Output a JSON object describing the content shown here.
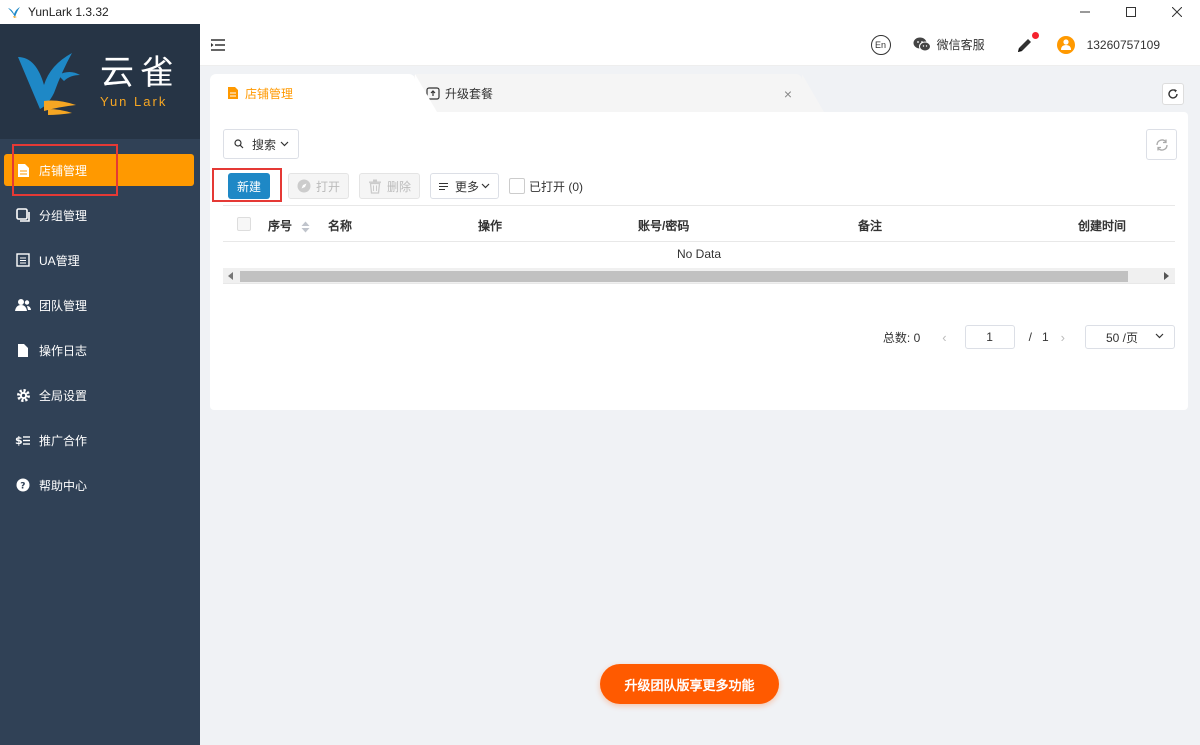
{
  "window": {
    "title": "YunLark 1.3.32"
  },
  "logo": {
    "cn": "云雀",
    "en": "Yun Lark"
  },
  "sidebar": {
    "items": [
      {
        "label": "店铺管理",
        "icon": "document-icon",
        "active": true
      },
      {
        "label": "分组管理",
        "icon": "copy-icon",
        "active": false
      },
      {
        "label": "UA管理",
        "icon": "list-icon",
        "active": false
      },
      {
        "label": "团队管理",
        "icon": "team-icon",
        "active": false
      },
      {
        "label": "操作日志",
        "icon": "file-icon",
        "active": false
      },
      {
        "label": "全局设置",
        "icon": "gear-icon",
        "active": false
      },
      {
        "label": "推广合作",
        "icon": "dollar-icon",
        "active": false
      },
      {
        "label": "帮助中心",
        "icon": "help-icon",
        "active": false
      }
    ]
  },
  "header": {
    "lang": "En",
    "wechat_label": "微信客服",
    "user_phone": "13260757109"
  },
  "tabs": [
    {
      "label": "店铺管理",
      "active": true
    },
    {
      "label": "升级套餐",
      "active": false
    }
  ],
  "toolbar": {
    "search_label": "搜索",
    "new_label": "新建",
    "open_label": "打开",
    "delete_label": "删除",
    "more_label": "更多",
    "opened_label": "已打开 (0)"
  },
  "table": {
    "columns": [
      "序号",
      "名称",
      "操作",
      "账号/密码",
      "备注",
      "创建时间"
    ],
    "empty_text": "No Data"
  },
  "pagination": {
    "total_label": "总数:",
    "total": "0",
    "current_page": "1",
    "page_sep": "/",
    "total_pages": "1",
    "page_size": "50 /页"
  },
  "promo": {
    "upgrade_label": "升级团队版享更多功能"
  },
  "colors": {
    "accent": "#ff9900",
    "sidebar_bg": "#304156",
    "primary_button": "#1e88c6",
    "upgrade_button": "#ff5a00"
  }
}
